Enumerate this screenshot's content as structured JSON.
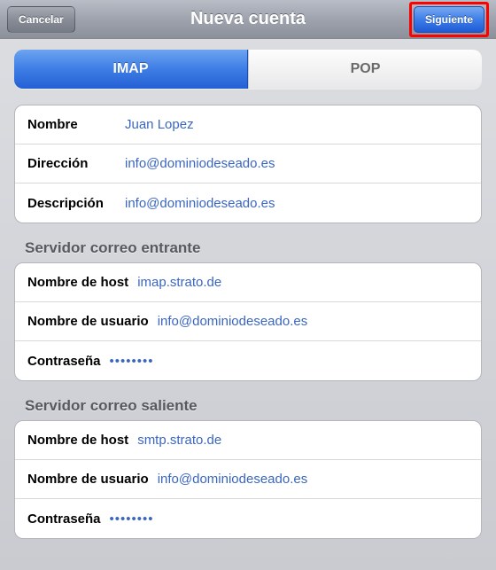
{
  "header": {
    "cancel": "Cancelar",
    "title": "Nueva cuenta",
    "next": "Siguiente"
  },
  "tabs": {
    "imap": "IMAP",
    "pop": "POP"
  },
  "account": {
    "name_label": "Nombre",
    "name_value": "Juan Lopez",
    "address_label": "Dirección",
    "address_value": "info@dominiodeseado.es",
    "description_label": "Descripción",
    "description_value": "info@dominiodeseado.es"
  },
  "incoming": {
    "header": "Servidor correo entrante",
    "host_label": "Nombre de host",
    "host_value": "imap.strato.de",
    "user_label": "Nombre de usuario",
    "user_value": "info@dominiodeseado.es",
    "pass_label": "Contraseña",
    "pass_value": "••••••••"
  },
  "outgoing": {
    "header": "Servidor correo saliente",
    "host_label": "Nombre de host",
    "host_value": "smtp.strato.de",
    "user_label": "Nombre de usuario",
    "user_value": "info@dominiodeseado.es",
    "pass_label": "Contraseña",
    "pass_value": "••••••••"
  }
}
